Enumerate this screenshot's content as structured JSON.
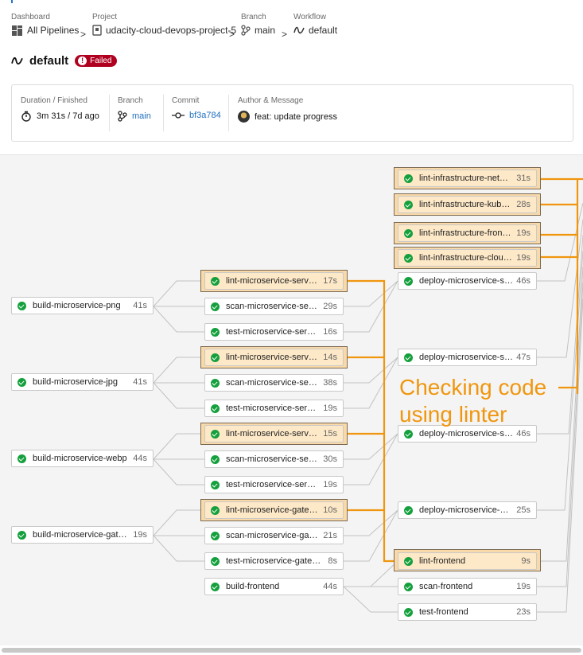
{
  "breadcrumbs": {
    "dashboard": {
      "label": "Dashboard",
      "value": "All Pipelines"
    },
    "project": {
      "label": "Project",
      "value": "udacity-cloud-devops-project-5"
    },
    "branch": {
      "label": "Branch",
      "value": "main"
    },
    "workflow": {
      "label": "Workflow",
      "value": "default"
    },
    "separator": ">"
  },
  "workflow": {
    "name": "default",
    "status": "Failed",
    "status_color": "#b00020"
  },
  "details": {
    "duration": {
      "label": "Duration / Finished",
      "value": "3m 31s / 7d ago"
    },
    "branch": {
      "label": "Branch",
      "value": "main"
    },
    "commit": {
      "label": "Commit",
      "value": "bf3a784"
    },
    "author": {
      "label": "Author & Message",
      "value": "feat: update progress"
    }
  },
  "colors": {
    "success": "#14a03c",
    "highlight": "#fde8c7",
    "annotation": "#f0960e",
    "link": "#1f6fbf"
  },
  "jobs": {
    "build_png": {
      "name": "build-microservice-png",
      "duration": "41s"
    },
    "build_jpg": {
      "name": "build-microservice-jpg",
      "duration": "41s"
    },
    "build_webp": {
      "name": "build-microservice-webp",
      "duration": "44s"
    },
    "build_gateway": {
      "name": "build-microservice-gatew...",
      "duration": "19s"
    },
    "lint_png": {
      "name": "lint-microservice-server-p...",
      "duration": "17s"
    },
    "scan_png": {
      "name": "scan-microservice-server-...",
      "duration": "29s"
    },
    "test_png": {
      "name": "test-microservice-server-...",
      "duration": "16s"
    },
    "lint_jpg": {
      "name": "lint-microservice-server-jpg",
      "duration": "14s"
    },
    "scan_jpg": {
      "name": "scan-microservice-server-...",
      "duration": "38s"
    },
    "test_jpg": {
      "name": "test-microservice-server-j...",
      "duration": "19s"
    },
    "lint_webp": {
      "name": "lint-microservice-server-w...",
      "duration": "15s"
    },
    "scan_webp": {
      "name": "scan-microservice-server-...",
      "duration": "30s"
    },
    "test_webp": {
      "name": "test-microservice-server-...",
      "duration": "19s"
    },
    "lint_gateway": {
      "name": "lint-microservice-gateway",
      "duration": "10s"
    },
    "scan_gateway": {
      "name": "scan-microservice-gatew...",
      "duration": "21s"
    },
    "test_gateway": {
      "name": "test-microservice-gateway",
      "duration": "8s"
    },
    "build_frontend": {
      "name": "build-frontend",
      "duration": "44s"
    },
    "lint_infra_network": {
      "name": "lint-infrastructure-network",
      "duration": "31s"
    },
    "lint_infra_kube": {
      "name": "lint-infrastructure-kubern...",
      "duration": "28s"
    },
    "lint_infra_frontend": {
      "name": "lint-infrastructure-frontend",
      "duration": "19s"
    },
    "lint_infra_cloudfront": {
      "name": "lint-infrastructure-cloudfr...",
      "duration": "19s"
    },
    "deploy_png": {
      "name": "deploy-microservice-serv...",
      "duration": "46s"
    },
    "deploy_jpg": {
      "name": "deploy-microservice-serv...",
      "duration": "47s"
    },
    "deploy_webp": {
      "name": "deploy-microservice-serv...",
      "duration": "46s"
    },
    "deploy_gateway": {
      "name": "deploy-microservice-gate...",
      "duration": "25s"
    },
    "lint_frontend": {
      "name": "lint-frontend",
      "duration": "9s"
    },
    "scan_frontend": {
      "name": "scan-frontend",
      "duration": "19s"
    },
    "test_frontend": {
      "name": "test-frontend",
      "duration": "23s"
    }
  },
  "annotation": {
    "line1": "Checking code",
    "line2": "using linter"
  },
  "icons": {
    "dashboard": "dashboard-grid-icon",
    "project": "project-repo-icon",
    "branch": "git-branch-icon",
    "workflow": "workflow-icon",
    "duration": "stopwatch-icon",
    "commit": "git-commit-icon",
    "status": "success-check-icon"
  }
}
